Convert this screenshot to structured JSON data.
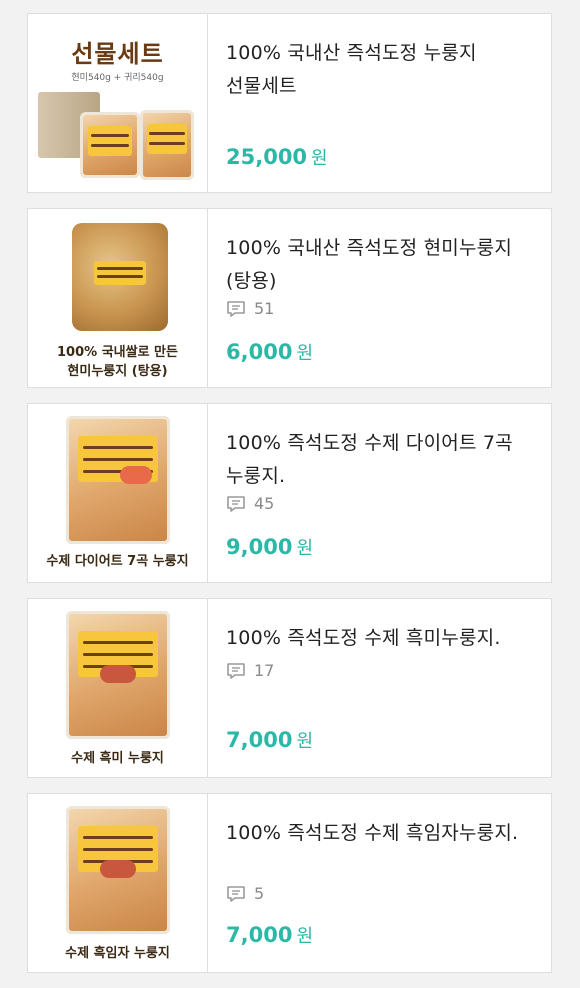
{
  "products": [
    {
      "title": "100% 국내산 즉석도정 누룽지 선물세트",
      "reviews": null,
      "price": "25,000",
      "unit": "원",
      "thumb_title": "선물세트",
      "thumb_sub": "현미540g + 귀리540g",
      "caption": ""
    },
    {
      "title": "100% 국내산 즉석도정 현미누룽지(탕용)",
      "reviews": "51",
      "price": "6,000",
      "unit": "원",
      "caption": "100% 국내쌀로 만든 현미누룽지 (탕용)"
    },
    {
      "title": "100% 즉석도정 수제 다이어트 7곡 누룽지.",
      "reviews": "45",
      "price": "9,000",
      "unit": "원",
      "caption": "수제 다이어트 7곡 누룽지"
    },
    {
      "title": "100% 즉석도정 수제 흑미누룽지.",
      "reviews": "17",
      "price": "7,000",
      "unit": "원",
      "caption": "수제 흑미 누룽지"
    },
    {
      "title": "100% 즉석도정 수제 흑임자누룽지.",
      "reviews": "5",
      "price": "7,000",
      "unit": "원",
      "caption": "수제 흑임자 누룽지"
    }
  ],
  "colors": {
    "price": "#2bb8a6",
    "title": "#222222",
    "meta": "#8a8a8a",
    "border": "#dedede",
    "background": "#f2f2f2"
  },
  "icons": {
    "review": "speech-bubble-icon"
  }
}
